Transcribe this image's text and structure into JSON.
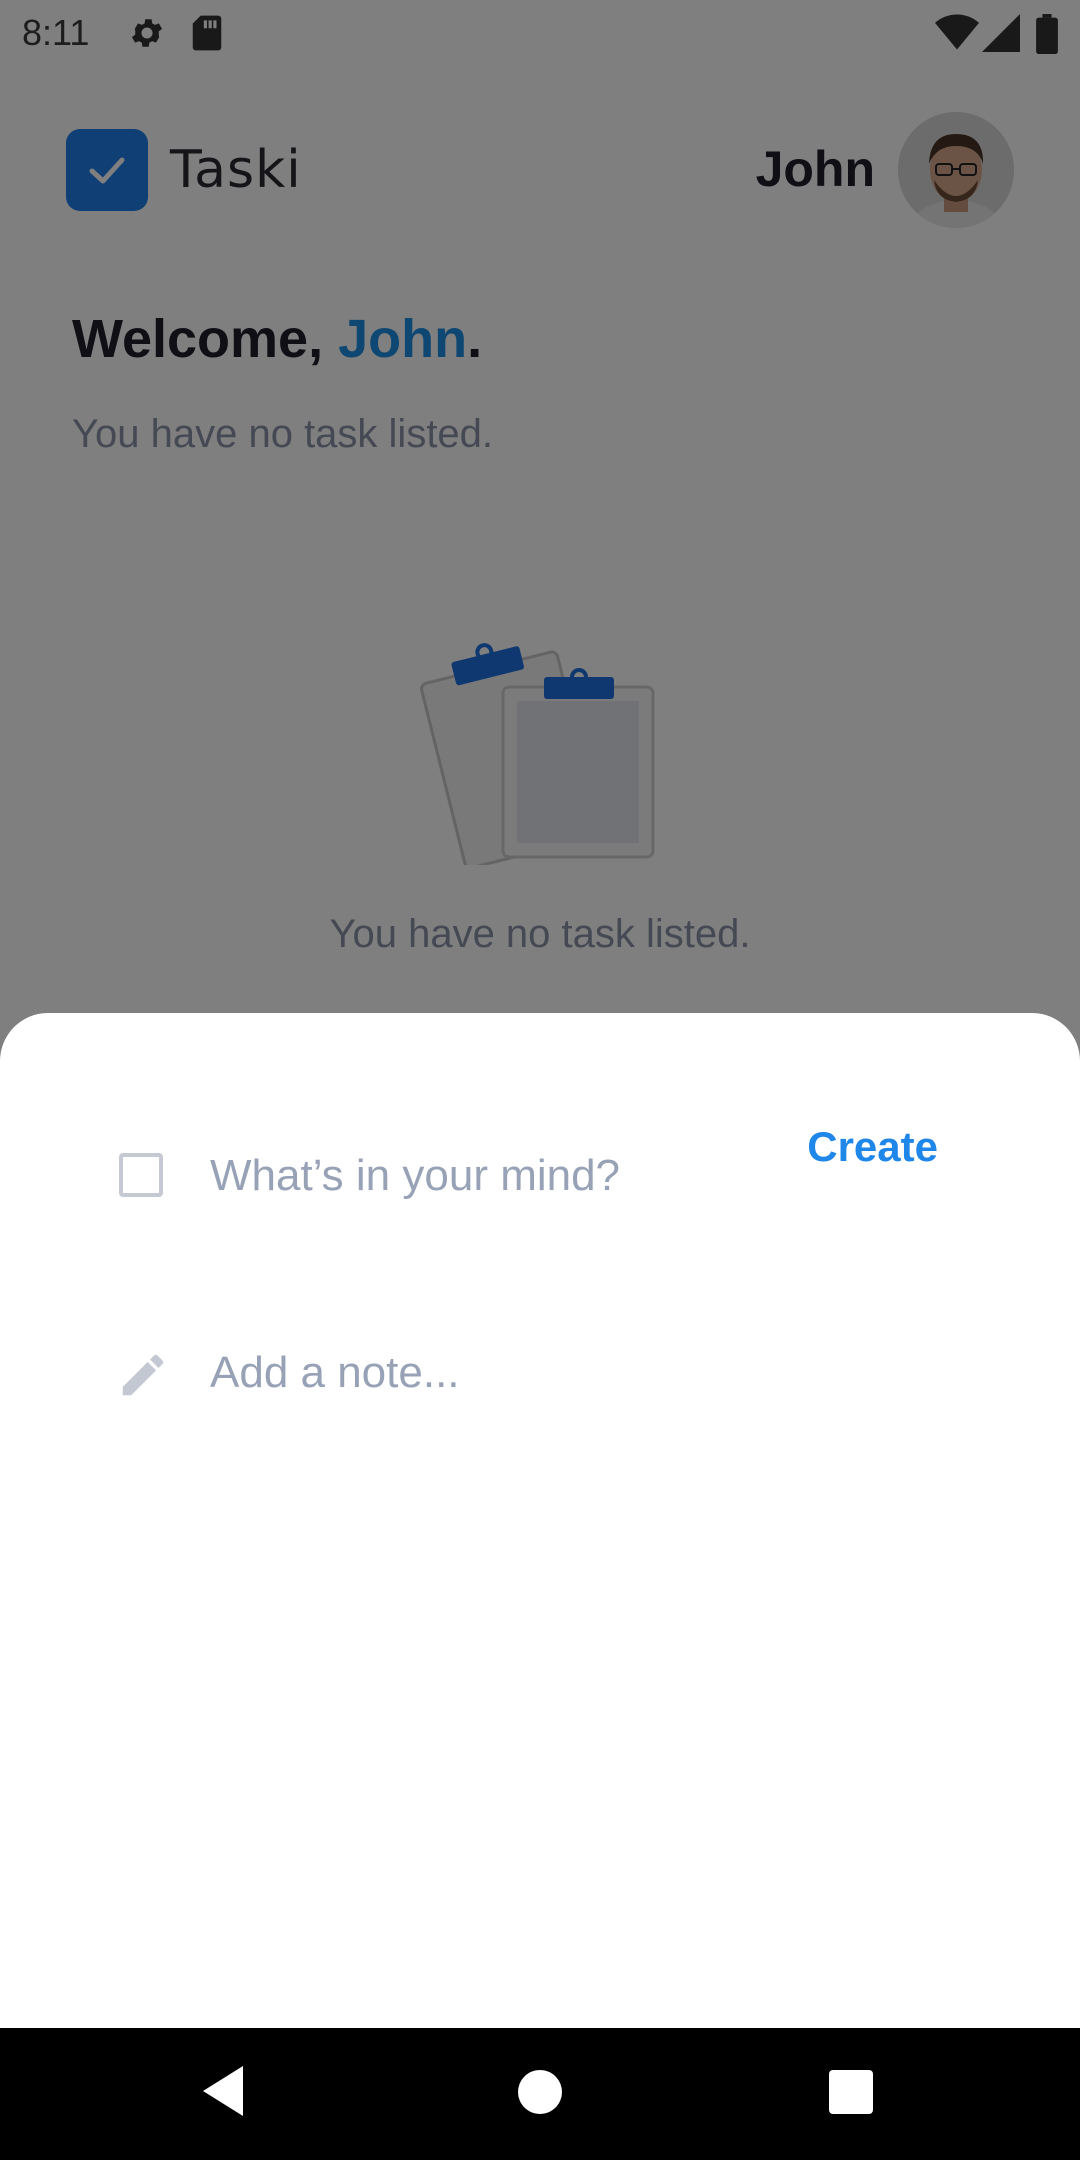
{
  "status_bar": {
    "time": "8:11",
    "icons": [
      "gear-icon",
      "sd-card-icon",
      "wifi-icon",
      "signal-icon",
      "battery-icon"
    ]
  },
  "header": {
    "app_name": "Taski",
    "user_name": "John"
  },
  "welcome": {
    "greeting": "Welcome, ",
    "name": "John",
    "punctuation": ".",
    "subtitle": "You have no task listed."
  },
  "empty_state": {
    "text": "You have no task listed."
  },
  "sheet": {
    "task_placeholder": "What’s in your mind?",
    "note_placeholder": "Add a note...",
    "create_label": "Create"
  },
  "colors": {
    "accent": "#1f86ea",
    "logo": "#1f7fe8",
    "placeholder": "#98a2b6",
    "text_dark": "#1e1e2a"
  }
}
